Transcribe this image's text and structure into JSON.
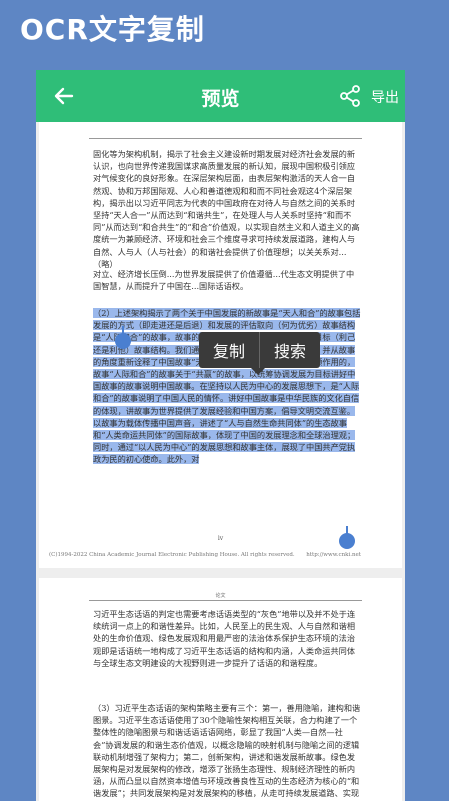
{
  "banner": {
    "title": "OCR文字复制"
  },
  "topbar": {
    "title": "预览",
    "export_label": "导出"
  },
  "page1": {
    "para1": "固化等为架构机制，揭示了社会主义建设新时期发展对经济社会发展的新认识，也向世界传递我国谋求高质量发展的新认知，展现中国积极引领应对气候变化的良好形象。在深层架构层面，由表层架构激活的天人合一自然观、协和万邦国际观、人心和善道德观和和而不同社会观这4个深层架构，揭示出以习近平同志为代表的中国政府在对待人与自然之间的关系时坚持“天人合一”从而达到“和谐共生”，在处理人与人关系时坚持“和而不同”从而达到“和合共生”的“和合”价值观，以实现自然主义和人道主义的高度统一为兼顾经济、环境和社会三个维度寻求可持续发展道路，建构人与自然、人与人（人与社会）的和谐社会提供了价值理想；以关关系对...（略）",
    "para2_plain": "对立、经济增长压倒...为世界发展提供了价值遵循...代生态文明提供了中国智慧，从而提升了中国在...国际话语权。",
    "para2_highlight": "（2）上述架构揭示了两个关于中国发展的新故事是“天人和合”的故事包括发展的方式（即走进还是后退）和发展的评估取向（何为优劣）故事结构是“人际和合”的故事，故事的方式（竞争还是合作）和发展的目标（利己还是利他）故事结构。我们通过故事的结构和规“发展”的蕴意，并从故事的角度重新诠释了中国故事”天人和合”的故事关于认知深层引领作用的，故事“人际和合”的故事关于“共赢”的故事，以统筹协调发展为目标讲好中国故事的故事说明中国故事。在坚持以人民为中心的发展思想下，是“人际和合”的故事说明了中国人民的情怀。讲好中国故事是中华民族的文化自信的体现，讲故事为世界提供了发展经验和中国方案，倡导文明交流互鉴。以故事为载体传播中国声音，讲述了“人与自然生命共同体”的生态故事和“人类命运共同体”的国际故事，体现了中国的发展理念和全球治理观；同时，通过“以人民为中心”的发展思想和故事主体，展现了中国共产党执政为民的初心使命。此外，对",
    "page_no": "iv",
    "footer_left": "(C)1994-2022 China Academic Journal Electronic Publishing House. All rights reserved.",
    "footer_right": "http://www.cnki.net"
  },
  "page2": {
    "header": "论文",
    "para1": "习近平生态话语的判定也需要考虑话语类型的“灰色”地带以及并不处于连续统词一点上的和谐性差异。比如，人民至上的民生观、人与自然和谐相处的生命价值观、绿色发展观和用最严密的法治体系保护生态环境的法治观即是话语统一地构成了习近平生态话语的结构和内涵，人类命运共同体与全球生态文明建设的大视野则进一步提升了话语的和谐程度。",
    "para2": "（3）习近平生态话语的架构策略主要有三个：第一，善用隐喻，建构和谐图景。习近平生态话语使用了30个隐喻性架构相互关联，合力构建了一个整体性的隐喻图景与和谐话语话语网络，彰显了我国“人类—自然—社会”协调发展的和谐生态价值观，以概念隐喻的映射机制与隐喻之间的逻辑联动机制增强了架构力；第二，创新架构，讲述和谐发展新故事。绿色发展架构是对发展架构的修改，增添了张扬生态理性、规制经济理性的新内涵，从而凸显以自然资本增值与环境改善良性互动的生态经济为核心的“和谐发展”；共同发展架构是对发展架构的移植，从走可持续发展道路、实现中华民族大复兴的发展目标转向以协同治理、成果共享维护人民共"
  },
  "popup": {
    "copy_label": "复制",
    "search_label": "搜索"
  }
}
